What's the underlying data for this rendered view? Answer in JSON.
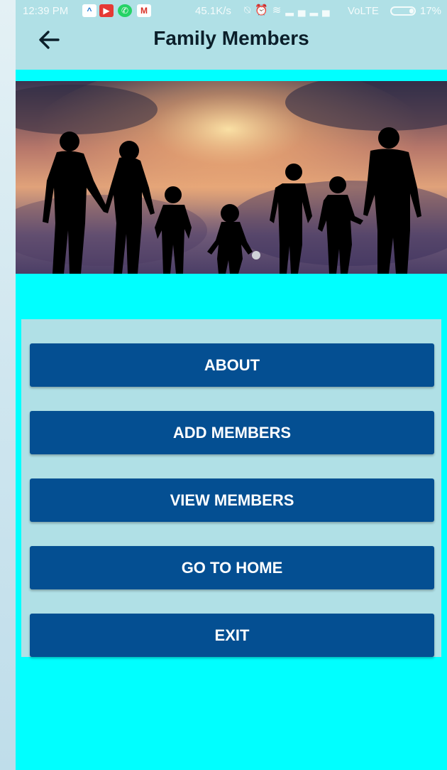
{
  "status_bar": {
    "time": "12:39 PM",
    "speed": "45.1K/s",
    "network": "VoLTE",
    "battery_percent": "17%",
    "notification_icons": [
      "arrow-up-notification-icon",
      "video-notification-icon",
      "whatsapp-notification-icon",
      "gmail-notification-icon"
    ],
    "system_icons": [
      "mute-icon",
      "alarm-icon",
      "wifi-icon",
      "signal-icon",
      "signal-icon"
    ]
  },
  "app_bar": {
    "title": "Family Members",
    "back_icon": "arrow-left-icon"
  },
  "banner": {
    "carousel_position": 1
  },
  "menu": {
    "buttons": [
      {
        "label": "ABOUT"
      },
      {
        "label": "ADD MEMBERS"
      },
      {
        "label": "VIEW MEMBERS"
      },
      {
        "label": "GO TO HOME"
      },
      {
        "label": "EXIT"
      }
    ]
  },
  "colors": {
    "app_bar": "#b0e0e6",
    "screen_background": "#00ffff",
    "button": "#044f92",
    "button_text": "#ffffff"
  }
}
